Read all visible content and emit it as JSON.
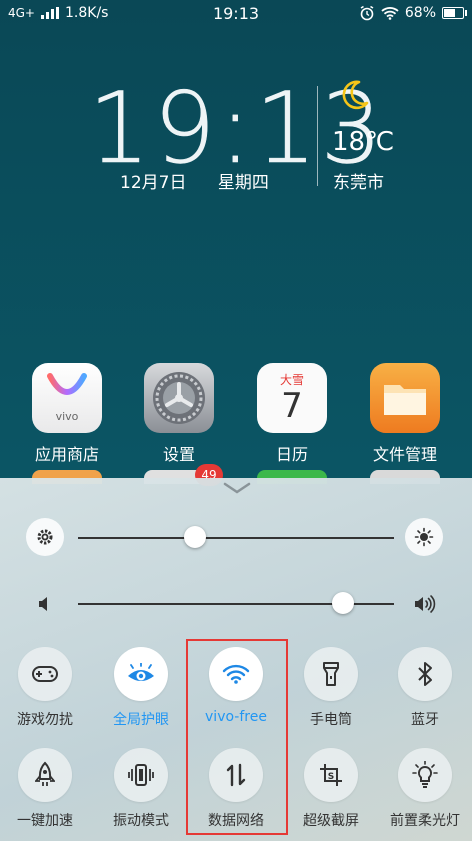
{
  "status_bar": {
    "network": "4G+",
    "speed": "1.8K/s",
    "time": "19:13",
    "battery": "68%",
    "battery_level": 0.68
  },
  "clock_widget": {
    "time": "19:13",
    "date": "12月7日",
    "weekday": "星期四",
    "temperature": "18℃",
    "city": "东莞市"
  },
  "apps": [
    {
      "label": "应用商店",
      "icon": "vivo-app-store-icon",
      "brand_text": "vivo"
    },
    {
      "label": "设置",
      "icon": "settings-gear-icon"
    },
    {
      "label": "日历",
      "icon": "calendar-icon",
      "header": "大雪",
      "day": "7"
    },
    {
      "label": "文件管理",
      "icon": "folder-icon"
    }
  ],
  "notification_badge": "49",
  "sliders": {
    "brightness": {
      "value": 0.37
    },
    "volume": {
      "value": 0.84
    }
  },
  "toggles": [
    {
      "label": "游戏勿扰",
      "icon": "gamepad-icon",
      "active": false
    },
    {
      "label": "全局护眼",
      "icon": "eye-icon",
      "active": true
    },
    {
      "label": "vivo-free",
      "icon": "wifi-icon",
      "active": true
    },
    {
      "label": "手电筒",
      "icon": "flashlight-icon",
      "active": false
    },
    {
      "label": "蓝牙",
      "icon": "bluetooth-icon",
      "active": false
    },
    {
      "label": "一键加速",
      "icon": "rocket-icon",
      "active": false
    },
    {
      "label": "振动模式",
      "icon": "vibrate-icon",
      "active": false
    },
    {
      "label": "数据网络",
      "icon": "data-arrows-icon",
      "active": false
    },
    {
      "label": "超级截屏",
      "icon": "screenshot-icon",
      "active": false
    },
    {
      "label": "前置柔光灯",
      "icon": "bulb-icon",
      "active": false
    }
  ],
  "colors": {
    "accent": "#2196f3",
    "highlight_box": "#e53935",
    "wallpaper": "#0b5564"
  }
}
